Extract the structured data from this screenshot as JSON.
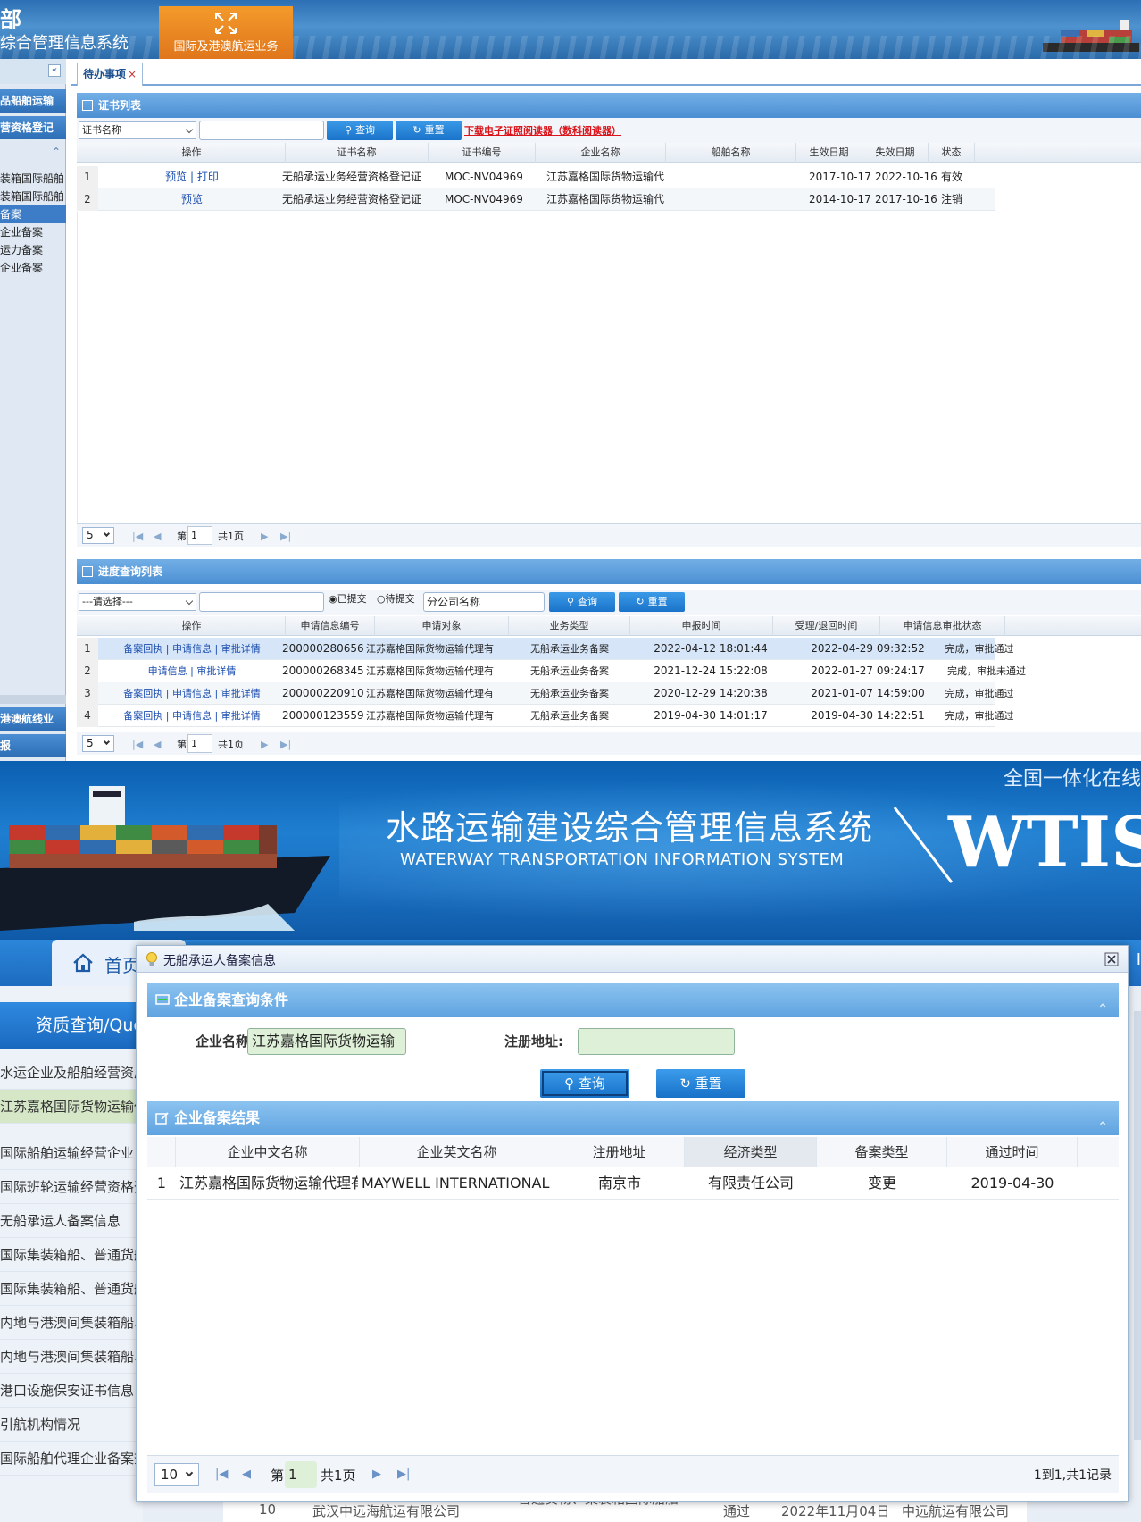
{
  "top": {
    "title_line1": "部",
    "title_line2": "综合管理信息系统",
    "business_tab": "国际及港澳航运业务",
    "collapse_glyph": "«",
    "left_nav": {
      "headers": [
        "品船舶运输",
        "营资格登记",
        "港澳航线业",
        "报"
      ],
      "items": [
        "装箱国际船舶",
        "装箱国际船舶",
        "备案",
        "企业备案",
        "运力备案",
        "企业备案"
      ],
      "section_glyph": "⌃"
    },
    "tab": {
      "label": "待办事项",
      "close": "×"
    },
    "cert_panel": {
      "title": "证书列表",
      "filter_select": "证书名称",
      "search_button": "查询",
      "reset_button": "重置",
      "download_link": "下载电子证照阅读器（数科阅读器）",
      "columns": [
        "操作",
        "证书名称",
        "证书编号",
        "企业名称",
        "船舶名称",
        "生效日期",
        "失效日期",
        "状态"
      ],
      "rows": [
        {
          "no": "1",
          "ops": [
            "预览",
            "打印"
          ],
          "name": "无船承运业务经营资格登记证",
          "cert_no": "MOC-NV04969",
          "company": "江苏嘉格国际货物运输代",
          "ship": "",
          "start": "2017-10-17",
          "end": "2022-10-16",
          "status": "有效"
        },
        {
          "no": "2",
          "ops": [
            "预览"
          ],
          "name": "无船承运业务经营资格登记证",
          "cert_no": "MOC-NV04969",
          "company": "江苏嘉格国际货物运输代",
          "ship": "",
          "start": "2014-10-17",
          "end": "2017-10-16",
          "status": "注销"
        }
      ],
      "pager": {
        "page_size": "5",
        "page_label": "第",
        "page": "1",
        "total": "共1页"
      }
    },
    "progress_panel": {
      "title": "进度查询列表",
      "filter_select": "---请选择---",
      "radio_submitted": "已提交",
      "radio_pending": "待提交",
      "branch_input": "分公司名称",
      "search_button": "查询",
      "reset_button": "重置",
      "columns": [
        "操作",
        "申请信息编号",
        "申请对象",
        "业务类型",
        "申报时间",
        "受理/退回时间",
        "申请信息审批状态"
      ],
      "rows": [
        {
          "no": "1",
          "ops": [
            "备案回执",
            "申请信息",
            "审批详情"
          ],
          "app_no": "200000280656",
          "target": "江苏嘉格国际货物运输代理有",
          "type": "无船承运业务备案",
          "submit": "2022-04-12 18:01:44",
          "accept": "2022-04-29 09:32:52",
          "status": "完成，审批通过"
        },
        {
          "no": "2",
          "ops": [
            "申请信息",
            "审批详情"
          ],
          "app_no": "200000268345",
          "target": "江苏嘉格国际货物运输代理有",
          "type": "无船承运业务备案",
          "submit": "2021-12-24 15:22:08",
          "accept": "2022-01-27 09:24:17",
          "status": "完成，审批未通过"
        },
        {
          "no": "3",
          "ops": [
            "备案回执",
            "申请信息",
            "审批详情"
          ],
          "app_no": "200000220910",
          "target": "江苏嘉格国际货物运输代理有",
          "type": "无船承运业务备案",
          "submit": "2020-12-29 14:20:38",
          "accept": "2021-01-07 14:59:00",
          "status": "完成，审批通过"
        },
        {
          "no": "4",
          "ops": [
            "备案回执",
            "申请信息",
            "审批详情"
          ],
          "app_no": "200000123559",
          "target": "江苏嘉格国际货物运输代理有",
          "type": "无船承运业务备案",
          "submit": "2019-04-30 14:01:17",
          "accept": "2019-04-30 14:22:51",
          "status": "完成，审批通过"
        }
      ],
      "pager": {
        "page_size": "5",
        "page_label": "第",
        "page": "1",
        "total": "共1页"
      }
    }
  },
  "bottom": {
    "hero_title_cn": "水路运输建设综合管理信息系统",
    "hero_title_en": "WATERWAY TRANSPORTATION INFORMATION SYSTEM",
    "hero_top_right": "全国一体化在线",
    "hero_logo": "WTIS",
    "home_tab": "首页",
    "strip_right": "I",
    "sidebar": {
      "title": "资质查询/Que",
      "items": [
        "水运企业及船舶经营资质",
        "江苏嘉格国际货物运输代",
        "国际船舶运输经营企业",
        "国际班轮运输经营资格登",
        "无船承运人备案信息",
        "国际集装箱船、普通货船",
        "国际集装箱船、普通货船",
        "内地与港澳间集装箱船、",
        "内地与港澳间集装箱船、",
        "港口设施保安证书信息",
        "引航机构情况",
        "国际船舶代理企业备案查询"
      ]
    },
    "bg_table_fragment": [
      "10",
      "武汉中远海航运有限公司",
      "普通货物、集装箱国际船舶",
      "通过",
      "2022年11月04日",
      "中远航运有限公司"
    ],
    "modal": {
      "title": "无船承运人备案信息",
      "query_section": "企业备案查询条件",
      "company_label": "企业名称:",
      "company_value": "江苏嘉格国际货物运输",
      "address_label": "注册地址:",
      "address_value": "",
      "search_button": "查询",
      "reset_button": "重置",
      "result_section": "企业备案结果",
      "columns": [
        "企业中文名称",
        "企业英文名称",
        "注册地址",
        "经济类型",
        "备案类型",
        "通过时间"
      ],
      "rows": [
        {
          "no": "1",
          "cn_name": "江苏嘉格国际货物运输代理有",
          "en_name": "MAYWELL INTERNATIONAL",
          "address": "南京市",
          "econ_type": "有限责任公司",
          "record_type": "变更",
          "pass_time": "2019-04-30"
        }
      ],
      "pager": {
        "page_size": "10",
        "page_label": "第",
        "page": "1",
        "total": "共1页",
        "summary": "1到1,共1记录"
      }
    }
  },
  "colors": {
    "accent_blue": "#2d6fb4",
    "orange_tab": "#e0761c",
    "link": "#1d4fb0",
    "download_red": "#d9141a",
    "input_green": "#dff0d8"
  }
}
